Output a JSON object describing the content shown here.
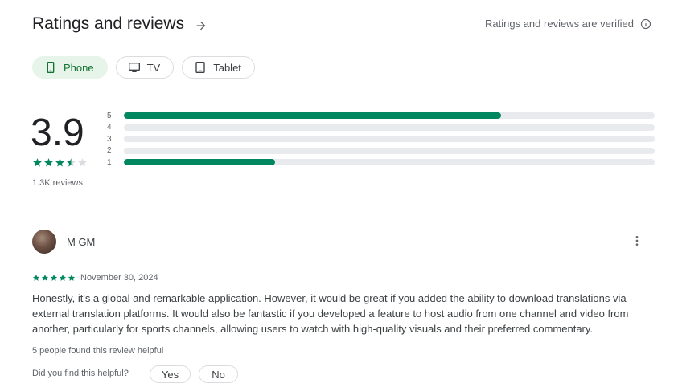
{
  "header": {
    "title": "Ratings and reviews",
    "verified_text": "Ratings and reviews are verified"
  },
  "device_chips": [
    {
      "label": "Phone",
      "icon": "phone-icon",
      "selected": true
    },
    {
      "label": "TV",
      "icon": "tv-icon",
      "selected": false
    },
    {
      "label": "Tablet",
      "icon": "tablet-icon",
      "selected": false
    }
  ],
  "summary": {
    "score": "3.9",
    "star_rating": 3.5,
    "review_count": "1.3K reviews",
    "distribution": [
      {
        "label": "5",
        "fraction": 0.71
      },
      {
        "label": "4",
        "fraction": 0.0
      },
      {
        "label": "3",
        "fraction": 0.0
      },
      {
        "label": "2",
        "fraction": 0.0
      },
      {
        "label": "1",
        "fraction": 0.285
      }
    ]
  },
  "review": {
    "author": "M GM",
    "stars": 5,
    "date": "November 30, 2024",
    "text": "Honestly, it's a global and remarkable application. However, it would be great if you added the ability to download translations via external translation platforms. It would also be fantastic if you developed a feature to host audio from one channel and video from another, particularly for sports channels, allowing users to watch with high-quality visuals and their preferred commentary.",
    "helpful_count": "5 people found this review helpful",
    "helpful_question": "Did you find this helpful?",
    "yes_label": "Yes",
    "no_label": "No"
  },
  "colors": {
    "accent": "#01875f",
    "chip_selected_bg": "#e6f4ea",
    "chip_selected_text": "#137333",
    "track": "#e8eaed"
  }
}
